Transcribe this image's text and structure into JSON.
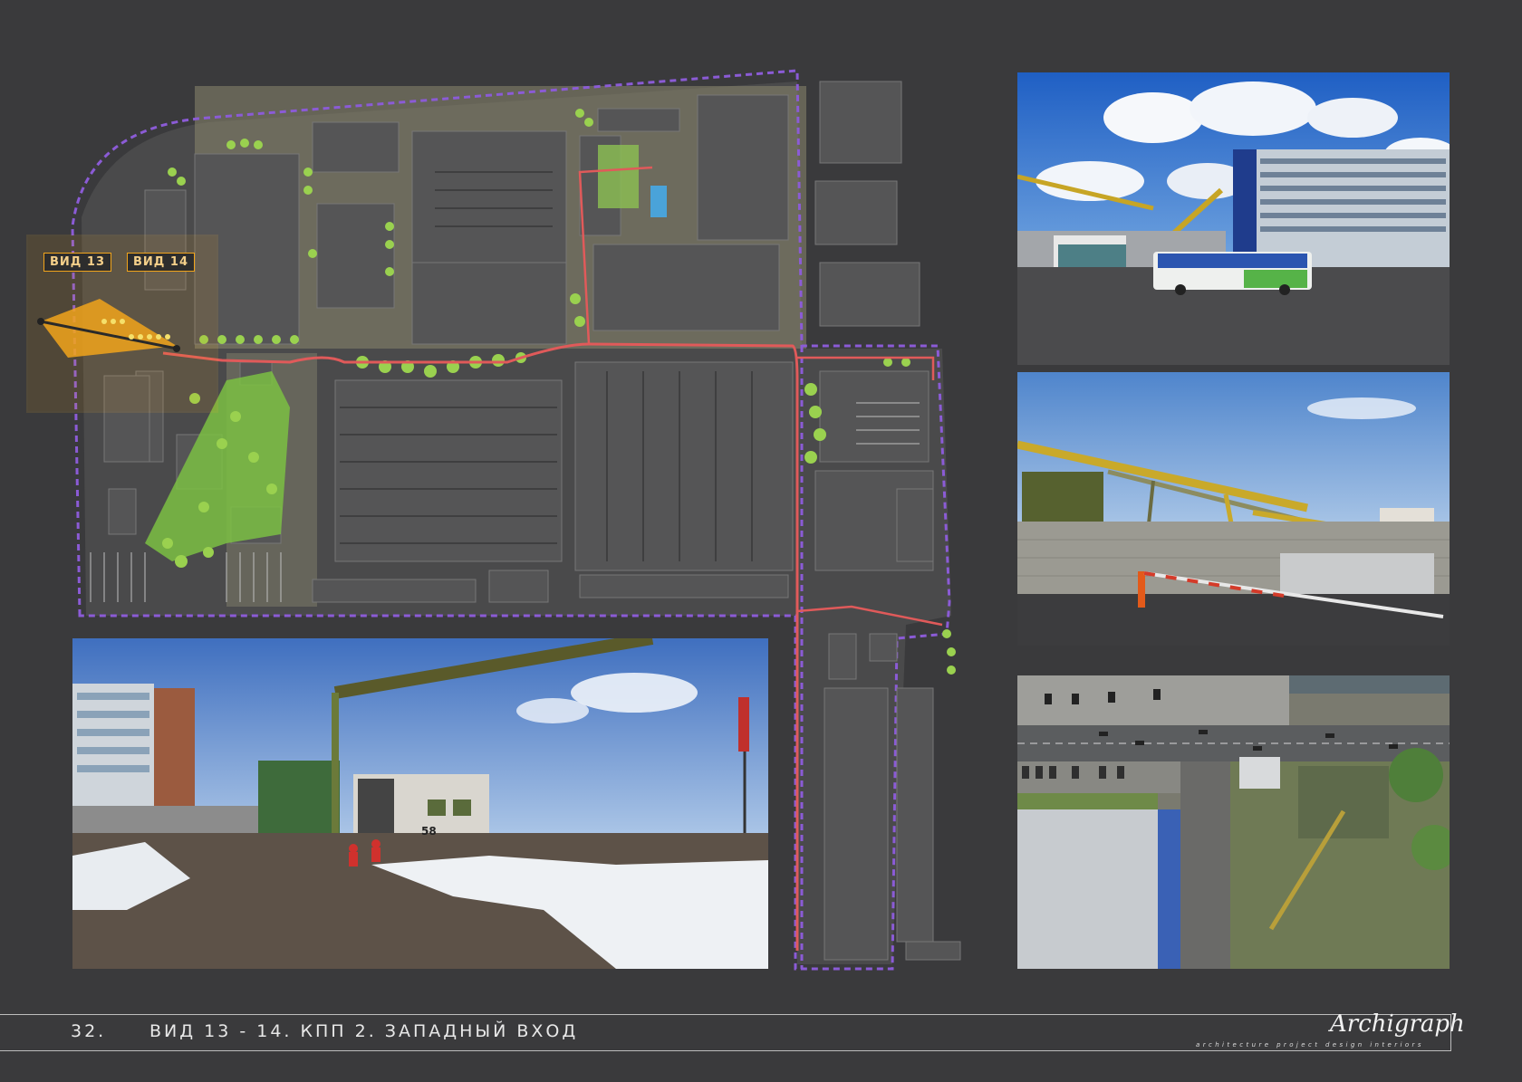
{
  "page": {
    "number": "32.",
    "title": "ВИД 13 - 14. КПП 2. ЗАПАДНЫЙ ВХОД"
  },
  "site_plan": {
    "view_labels": [
      "ВИД 13",
      "ВИД 14"
    ],
    "gate_number": "58",
    "colors": {
      "background": "#3a3a3c",
      "buildings": "#555556",
      "boundary": "#8b5bd6",
      "route": "#e05a5a",
      "highlight": "#f1a41b",
      "greenery": "#7bc043"
    }
  },
  "logo": {
    "script": "Archigraph",
    "tagline": "architecture project design interiors"
  }
}
